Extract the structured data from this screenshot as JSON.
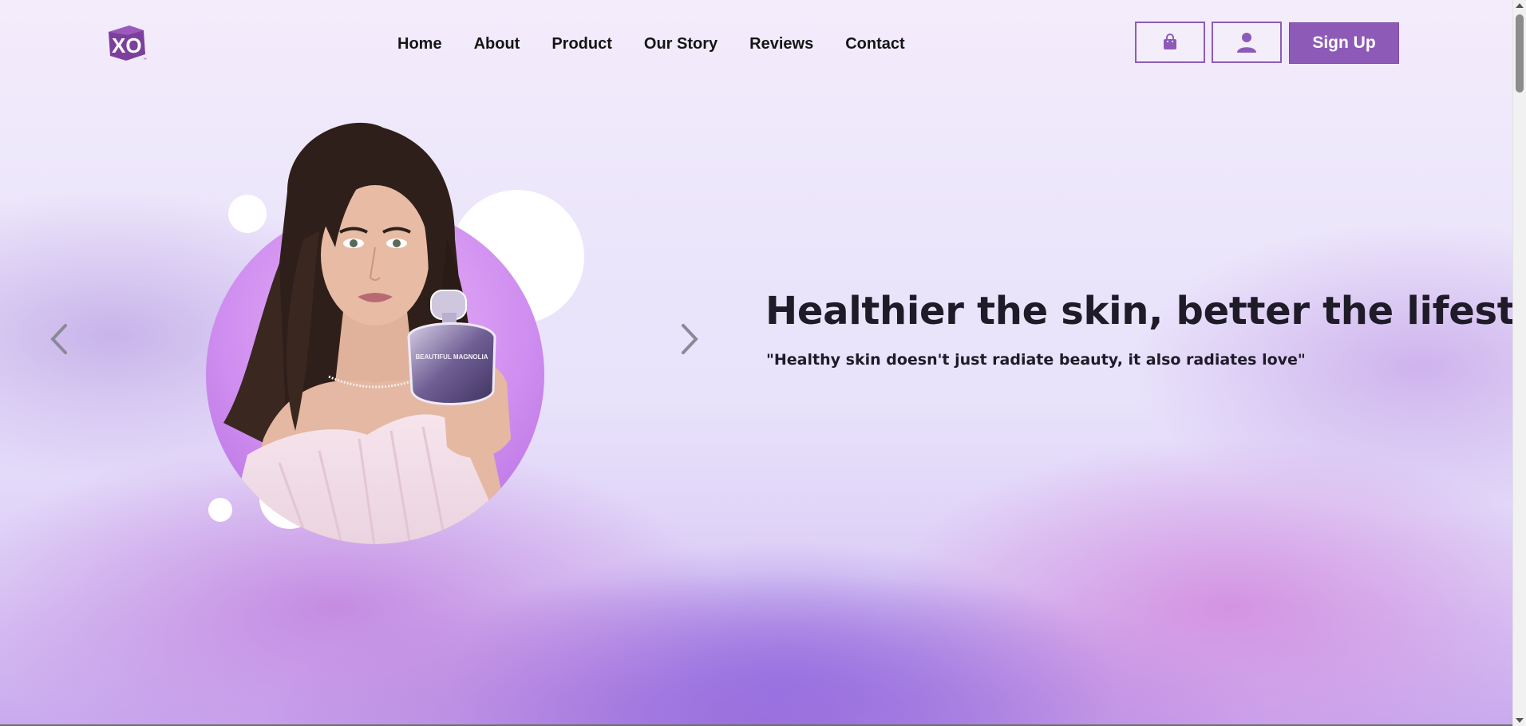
{
  "brand": {
    "logo_text": "XO",
    "colors": {
      "primary": "#8d5bb7",
      "accent": "#c98ef0",
      "text": "#151515"
    }
  },
  "nav": {
    "items": [
      {
        "label": "Home"
      },
      {
        "label": "About"
      },
      {
        "label": "Product"
      },
      {
        "label": "Our Story"
      },
      {
        "label": "Reviews"
      },
      {
        "label": "Contact"
      }
    ]
  },
  "header_actions": {
    "cart_icon": "shopping-bag-icon",
    "account_icon": "user-icon",
    "signup_label": "Sign Up"
  },
  "hero": {
    "title": "Healthier the skin, better the lifestyle",
    "quote": "\"Healthy skin doesn't just radiate beauty, it also radiates love\"",
    "prev_icon": "chevron-left-icon",
    "next_icon": "chevron-right-icon",
    "perfume_label": "BEAUTIFUL MAGNOLIA"
  }
}
